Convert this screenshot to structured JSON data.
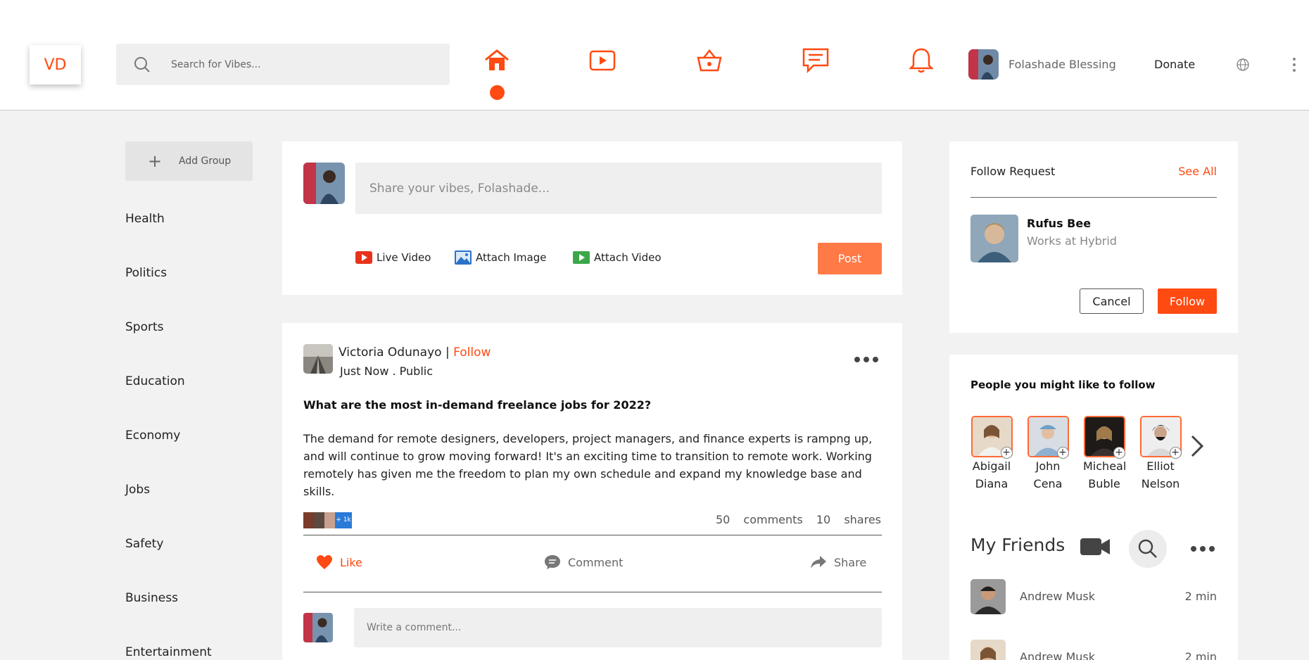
{
  "header": {
    "logo": "VD",
    "search_placeholder": "Search for Vibes...",
    "nav": [
      "home-icon",
      "video-play-icon",
      "basket-icon",
      "chat-icon",
      "bell-icon"
    ],
    "user_name": "Folashade Blessing",
    "donate": "Donate"
  },
  "sidebar": {
    "add_group": "Add Group",
    "groups": [
      "Health",
      "Politics",
      "Sports",
      "Education",
      "Economy",
      "Jobs",
      "Safety",
      "Business",
      "Entertainment"
    ]
  },
  "composer": {
    "placeholder": "Share your vibes, Folashade...",
    "actions": [
      "Live Video",
      "Attach Image",
      "Attach Video"
    ],
    "post_label": "Post"
  },
  "post": {
    "author": "Victoria Odunayo",
    "separator": "|",
    "follow": "Follow",
    "meta": "Just Now . Public",
    "title": "What are the most in-demand freelance jobs for 2022?",
    "body": "The demand for remote designers, developers, project managers, and finance experts is rampng up, and will continue to grow moving forward! It's an exciting time to transition to remote work. Working remotely has given me the freedom to plan my own schedule and expand my knowledge base and skills.",
    "reaction_badge": "+ 1k",
    "comments_count": "50",
    "comments_label": "comments",
    "shares_count": "10",
    "shares_label": "shares",
    "like": "Like",
    "comment": "Comment",
    "share": "Share",
    "comment_placeholder": "Write a comment..."
  },
  "follow_request": {
    "title": "Follow Request",
    "see_all": "See All",
    "name": "Rufus Bee",
    "subtitle": "Works at Hybrid",
    "cancel": "Cancel",
    "follow": "Follow"
  },
  "suggestions": {
    "title": "People you might like to follow",
    "people": [
      {
        "first": "Abigail",
        "last": "Diana"
      },
      {
        "first": "John",
        "last": "Cena"
      },
      {
        "first": "Micheal",
        "last": "Buble"
      },
      {
        "first": "Elliot",
        "last": "Nelson"
      }
    ]
  },
  "friends": {
    "title": "My Friends",
    "list": [
      {
        "name": "Andrew Musk",
        "time": "2 min"
      },
      {
        "name": "Andrew Musk",
        "time": "2 min"
      }
    ]
  },
  "colors": {
    "accent": "#ff4a12",
    "post_button": "#ff7a47",
    "background": "#f2f2f2"
  }
}
